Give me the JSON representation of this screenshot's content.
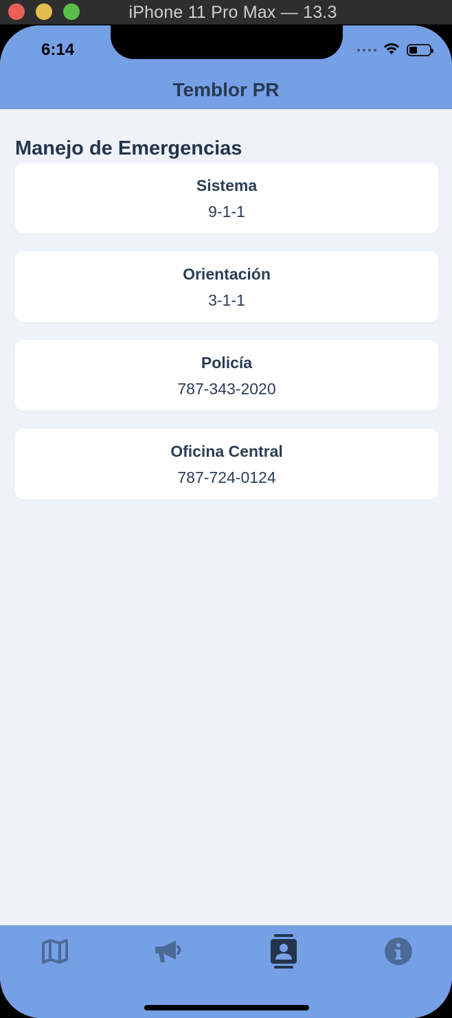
{
  "window": {
    "title": "iPhone 11 Pro Max — 13.3"
  },
  "status_bar": {
    "time": "6:14",
    "icons": [
      "cellular-signal-icon",
      "wifi-icon",
      "battery-icon"
    ]
  },
  "header": {
    "title": "Temblor PR"
  },
  "section": {
    "title": "Manejo de Emergencias"
  },
  "contacts": [
    {
      "name": "Sistema",
      "phone": "9-1-1"
    },
    {
      "name": "Orientación",
      "phone": "3-1-1"
    },
    {
      "name": "Policía",
      "phone": "787-343-2020"
    },
    {
      "name": "Oficina Central",
      "phone": "787-724-0124"
    }
  ],
  "tabbar": {
    "tabs": [
      {
        "icon": "map-icon",
        "selected": false
      },
      {
        "icon": "megaphone-icon",
        "selected": false
      },
      {
        "icon": "contact-card-icon",
        "selected": true
      },
      {
        "icon": "info-icon",
        "selected": false
      }
    ]
  },
  "colors": {
    "accent": "#76a0e6",
    "background": "#eff3f9",
    "text": "#2b3d55",
    "tab_inactive": "#4b6a96",
    "tab_active": "#24344c"
  }
}
